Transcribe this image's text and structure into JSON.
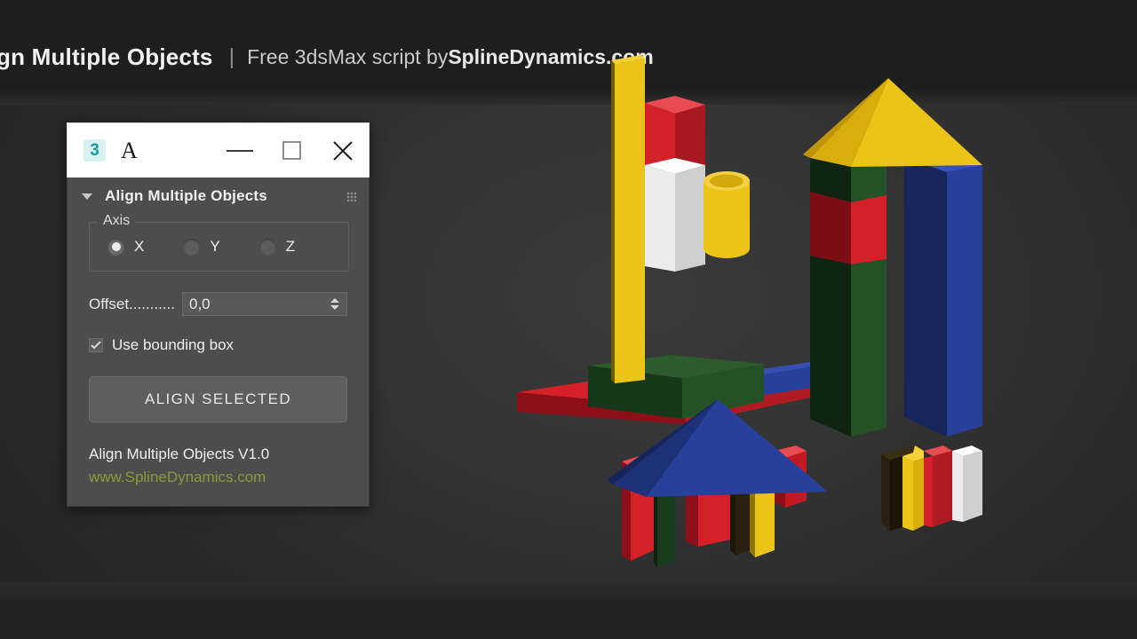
{
  "header": {
    "title": "gn Multiple Objects",
    "separator": "|",
    "subtitle_prefix": "Free 3dsMax script by ",
    "brand": "SplineDynamics.com"
  },
  "dialog": {
    "titlebar": {
      "logo_text": "3",
      "logo_name": "3dsmax-logo-icon",
      "app_letter": "A",
      "minimize_label": "—",
      "maximize_label": "□",
      "close_label": "✕"
    },
    "rollout": {
      "title": "Align Multiple Objects",
      "collapse_arrow": "▼",
      "grip": "grip-dots-icon"
    },
    "axis_group": {
      "label": "Axis",
      "options": [
        {
          "label": "X",
          "selected": true
        },
        {
          "label": "Y",
          "selected": false
        },
        {
          "label": "Z",
          "selected": false
        }
      ]
    },
    "offset": {
      "label": "Offset...........",
      "value": "0,0"
    },
    "bounding": {
      "label": "Use bounding box",
      "checked": true
    },
    "action_button": {
      "label": "ALIGN SELECTED"
    },
    "footer": {
      "version": "Align Multiple Objects V1.0",
      "link": "www.SplineDynamics.com",
      "link_color": "#8b9a38"
    }
  },
  "scene": {
    "description": "3D viewport with colored toy building blocks",
    "palette": {
      "yellow": "#ecc417",
      "yellow_dark": "#b89a0d",
      "yellow_side": "#d9ae0c",
      "red": "#d51f29",
      "red_dark": "#8d0f17",
      "red_side": "#b01a22",
      "blue": "#27409a",
      "blue_dark": "#16255c",
      "blue_side": "#1d3178",
      "green": "#245227",
      "green_dark": "#0e2310",
      "green_side": "#1a3c1c",
      "white": "#ececec",
      "white_side": "#cfcfcf",
      "background": "#343434"
    }
  }
}
